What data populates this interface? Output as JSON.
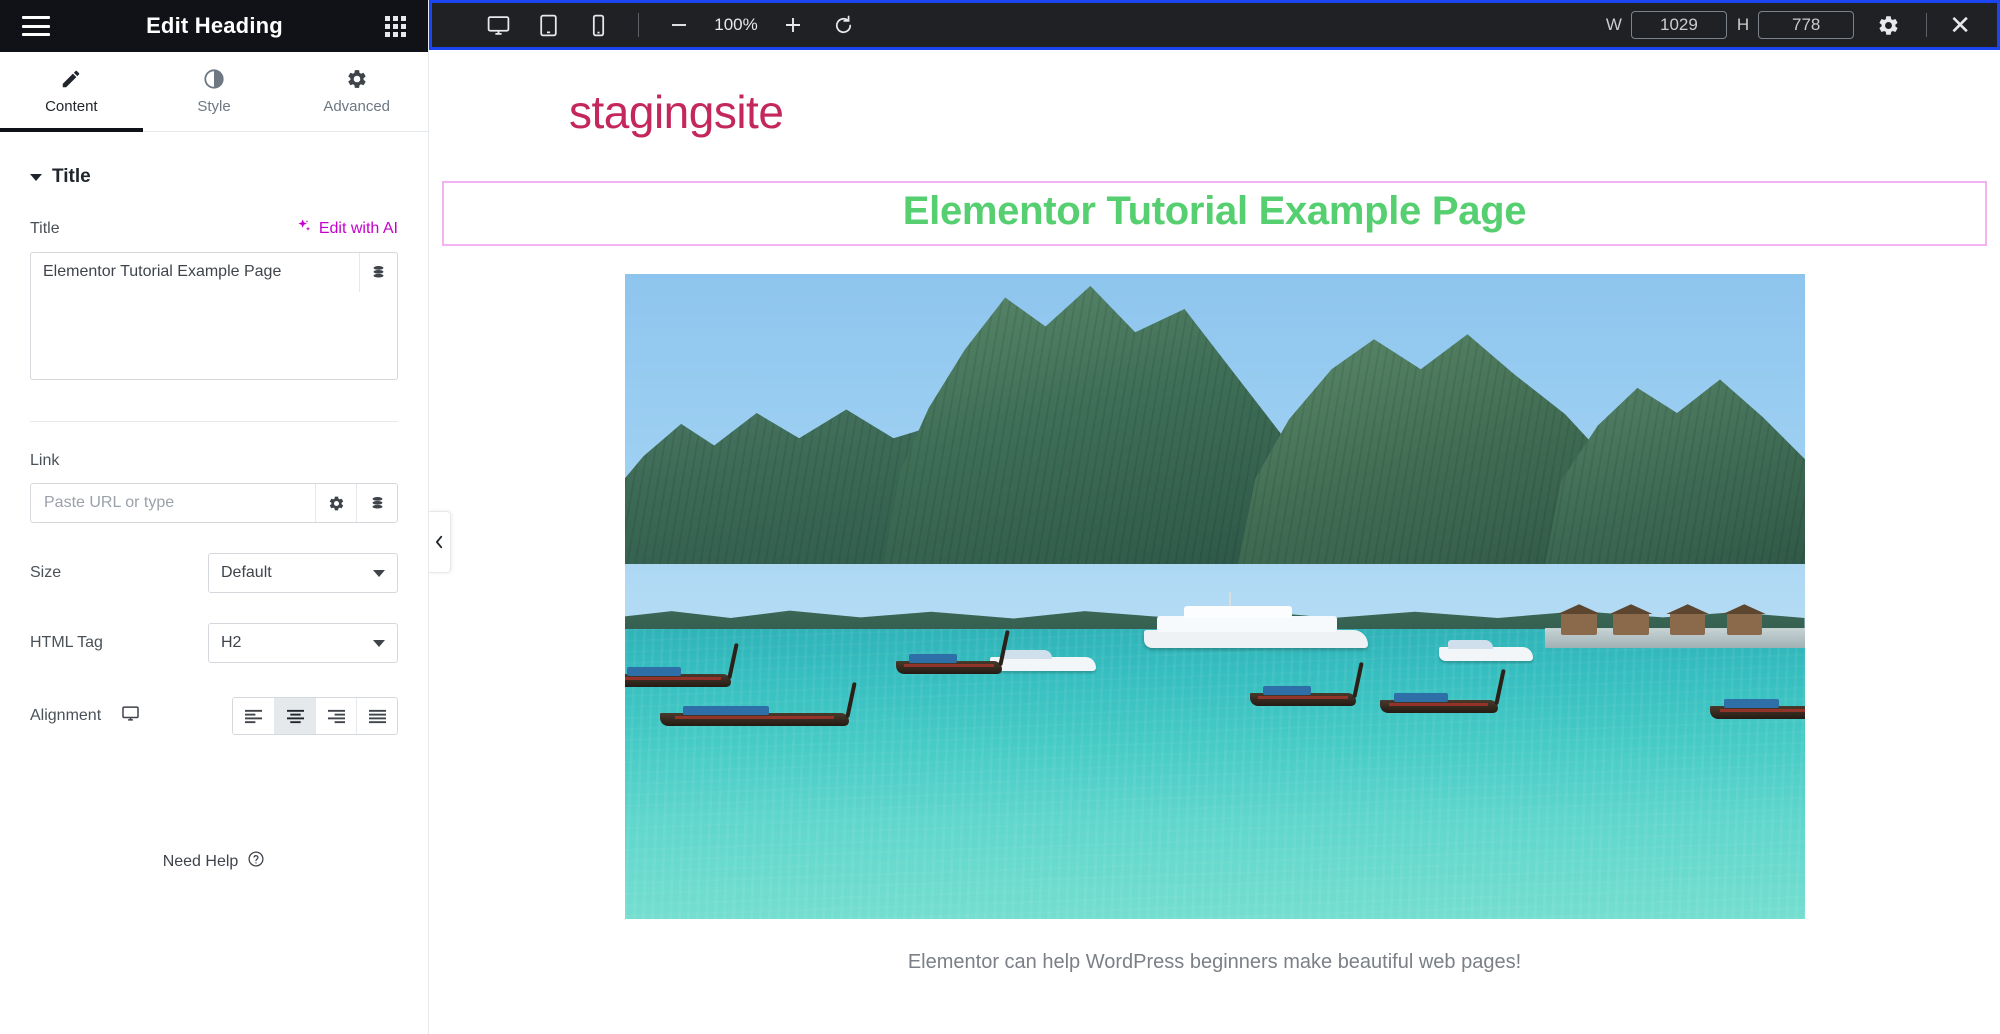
{
  "panel": {
    "title": "Edit Heading",
    "menu_icon": "hamburger-menu-icon",
    "apps_icon": "apps-grid-icon",
    "tabs": [
      {
        "label": "Content",
        "icon": "pencil-icon",
        "active": true
      },
      {
        "label": "Style",
        "icon": "contrast-icon",
        "active": false
      },
      {
        "label": "Advanced",
        "icon": "gear-icon",
        "active": false
      }
    ],
    "section": {
      "label": "Title",
      "expanded": true,
      "caret": "caret-down-icon"
    },
    "title_field": {
      "label": "Title",
      "ai_label": "Edit with AI",
      "ai_icon": "sparkle-icon",
      "value": "Elementor Tutorial Example Page",
      "dynamic_icon": "dynamic-tags-icon"
    },
    "link_field": {
      "label": "Link",
      "value": "",
      "placeholder": "Paste URL or type",
      "options_icon": "gear-icon",
      "dynamic_icon": "dynamic-tags-icon"
    },
    "size_field": {
      "label": "Size",
      "value": "Default",
      "arrow": "caret-down-icon"
    },
    "html_tag_field": {
      "label": "HTML Tag",
      "value": "H2",
      "arrow": "caret-down-icon"
    },
    "alignment_field": {
      "label": "Alignment",
      "device_icon": "desktop-icon",
      "selected": "center",
      "options": [
        "left",
        "center",
        "right",
        "justify"
      ]
    },
    "need_help": {
      "label": "Need Help",
      "icon": "question-circle-icon"
    }
  },
  "toolbar": {
    "devices": [
      {
        "name": "desktop",
        "icon": "desktop-icon",
        "active": true
      },
      {
        "name": "tablet",
        "icon": "tablet-icon",
        "active": false
      },
      {
        "name": "mobile",
        "icon": "mobile-icon",
        "active": false
      }
    ],
    "zoom_out_icon": "minus-icon",
    "zoom_level": "100%",
    "zoom_in_icon": "plus-icon",
    "reset_icon": "reset-rotate-icon",
    "width_label": "W",
    "width_value": "1029",
    "height_label": "H",
    "height_value": "778",
    "settings_icon": "gear-icon",
    "close_icon": "close-x-icon",
    "focus_border_color": "#1a45f0"
  },
  "canvas": {
    "collapse_icon": "chevron-left-icon",
    "site_title": "stagingsite",
    "site_title_color": "#c4275b",
    "heading": "Elementor Tutorial Example Page",
    "heading_color": "#56cf70",
    "selection_border_color": "#f3b3f0",
    "image_alt": "tropical bay with limestone cliffs and longtail boats",
    "caption": "Elementor can help WordPress beginners make beautiful web pages!"
  }
}
